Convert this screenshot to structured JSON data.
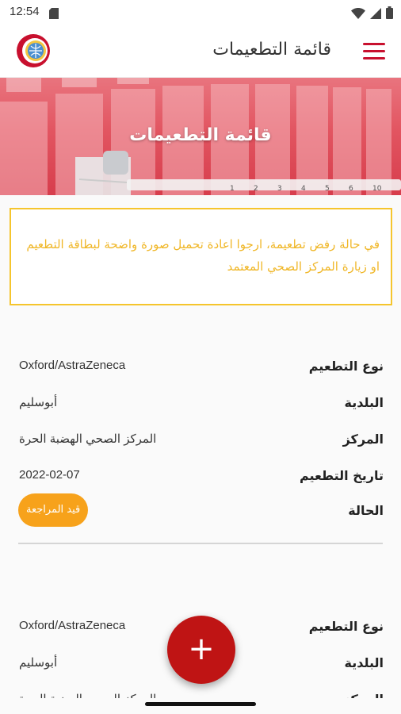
{
  "status_bar": {
    "time": "12:54"
  },
  "app_bar": {
    "title": "قائمة التطعيمات"
  },
  "banner": {
    "title": "قائمة التطعيمات"
  },
  "notice": {
    "text": "في حالة رفض تطعيمة، ارجوا اعادة تحميل صورة واضحة لبطاقة التطعيم او زيارة المركز الصحي المعتمد"
  },
  "labels": {
    "vaccine_type": "نوع التطعيم",
    "municipality": "البلدية",
    "center": "المركز",
    "date": "تاريخ التطعيم",
    "status": "الحالة"
  },
  "records": [
    {
      "vaccine_type": "Oxford/AstraZeneca",
      "municipality": "أبوسليم",
      "center": "المركز الصحي الهضبة الحرة",
      "date": "2022-02-07",
      "status": "قيد المراجعة"
    },
    {
      "vaccine_type": "Oxford/AstraZeneca",
      "municipality": "أبوسليم",
      "center": "المركز الصحي الهضبة الحرة"
    }
  ],
  "fab": {
    "label": "+"
  },
  "colors": {
    "brand_red": "#c8102e",
    "notice_yellow": "#f5c52d",
    "badge_orange": "#f7a21b",
    "fab_red": "#bf1414"
  }
}
